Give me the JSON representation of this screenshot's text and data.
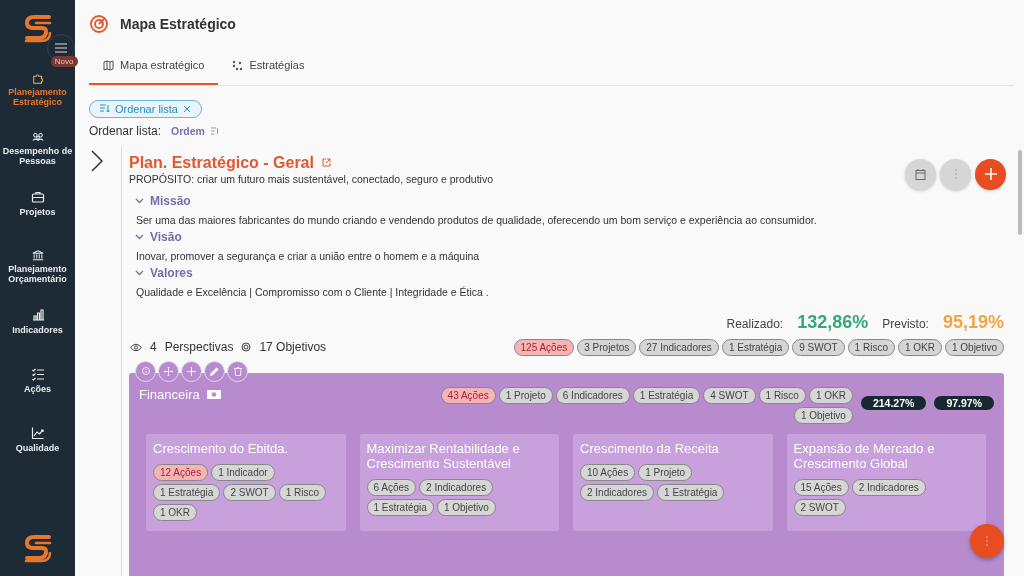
{
  "sidebar": {
    "items": [
      {
        "label": "Planejamento Estratégico",
        "kind": "puzzle",
        "selected": true,
        "badge": "Novo"
      },
      {
        "label": "Desempenho de Pessoas",
        "kind": "people",
        "selected": false
      },
      {
        "label": "Projetos",
        "kind": "briefcase",
        "selected": false
      },
      {
        "label": "Planejamento Orçamentário",
        "kind": "bank",
        "selected": false
      },
      {
        "label": "Indicadores",
        "kind": "bars",
        "selected": false
      },
      {
        "label": "Ações",
        "kind": "checklist",
        "selected": false
      },
      {
        "label": "Qualidade",
        "kind": "trend",
        "selected": false
      }
    ]
  },
  "header": {
    "title": "Mapa Estratégico"
  },
  "tabs": [
    {
      "label": "Mapa estratégico",
      "kind": "map",
      "selected": true
    },
    {
      "label": "Estratégias",
      "kind": "nodes",
      "selected": false
    }
  ],
  "filter_chip": {
    "label": "Ordenar lista"
  },
  "sort": {
    "label": "Ordenar lista:",
    "value": "Ordem"
  },
  "plan": {
    "title": "Plan. Estratégico - Geral",
    "purpose": "PROPÓSITO: criar um futuro mais sustentável, conectado, seguro e produtivo",
    "sections": [
      {
        "heading": "Missão",
        "expanded": true,
        "text": "Ser uma das maiores fabricantes do mundo criando e vendendo produtos de qualidade, oferecendo um bom serviço e experiência ao consumidor."
      },
      {
        "heading": "Visão",
        "expanded": true,
        "text": "Inovar, promover a segurança e criar a união entre o homem e a máquina"
      },
      {
        "heading": "Valores",
        "expanded": true,
        "text": "Qualidade e Excelência | Compromisso com o Cliente | Integridade e Ética ."
      }
    ],
    "realized_label": "Realizado:",
    "realized": "132,86%",
    "forecast_label": "Previsto:",
    "forecast": "95,19%",
    "perspectives_count": "4",
    "perspectives_label": "Perspectivas",
    "objectives_count": "17 Objetivos",
    "tags": [
      {
        "label": "125 Ações",
        "highlighted": true
      },
      {
        "label": "3 Projetos",
        "highlighted": false
      },
      {
        "label": "27 Indicadores",
        "highlighted": false
      },
      {
        "label": "1 Estratégia",
        "highlighted": false
      },
      {
        "label": "9 SWOT",
        "highlighted": false
      },
      {
        "label": "1 Risco",
        "highlighted": false
      },
      {
        "label": "1 OKR",
        "highlighted": false
      },
      {
        "label": "1 Objetivo",
        "highlighted": false
      }
    ]
  },
  "perspectives": [
    {
      "name": "Financeira",
      "realized": "214.27%",
      "forecast": "97.97%",
      "tags": [
        {
          "label": "43 Ações",
          "highlighted": true
        },
        {
          "label": "1 Projeto",
          "highlighted": false
        },
        {
          "label": "6 Indicadores",
          "highlighted": false
        },
        {
          "label": "1 Estratégia",
          "highlighted": false
        },
        {
          "label": "4 SWOT",
          "highlighted": false
        },
        {
          "label": "1 Risco",
          "highlighted": false
        },
        {
          "label": "1 OKR",
          "highlighted": false
        },
        {
          "label": "1 Objetivo",
          "highlighted": false
        }
      ],
      "objectives": [
        {
          "title": "Crescimento do Ebitda.",
          "tags": [
            {
              "label": "12 Ações",
              "highlighted": true
            },
            {
              "label": "1 Indicador",
              "highlighted": false
            },
            {
              "label": "1 Estratégia",
              "highlighted": false
            },
            {
              "label": "2 SWOT",
              "highlighted": false
            },
            {
              "label": "1 Risco",
              "highlighted": false
            },
            {
              "label": "1 OKR",
              "highlighted": false
            }
          ]
        },
        {
          "title": "Maximizar Rentabilidade e Crescimento Sustentável",
          "tags": [
            {
              "label": "6 Ações",
              "highlighted": false
            },
            {
              "label": "2 Indicadores",
              "highlighted": false
            },
            {
              "label": "1 Estratégia",
              "highlighted": false
            },
            {
              "label": "1 Objetivo",
              "highlighted": false
            }
          ]
        },
        {
          "title": "Crescimento da Receita",
          "tags": [
            {
              "label": "10 Ações",
              "highlighted": false
            },
            {
              "label": "1 Projeto",
              "highlighted": false
            },
            {
              "label": "2 Indicadores",
              "highlighted": false
            },
            {
              "label": "1 Estratégia",
              "highlighted": false
            }
          ]
        },
        {
          "title": "Expansão de Mercado e Crescimento Global",
          "tags": [
            {
              "label": "15 Ações",
              "highlighted": false
            },
            {
              "label": "2 Indicadores",
              "highlighted": false
            },
            {
              "label": "2 SWOT",
              "highlighted": false
            }
          ]
        }
      ]
    }
  ]
}
